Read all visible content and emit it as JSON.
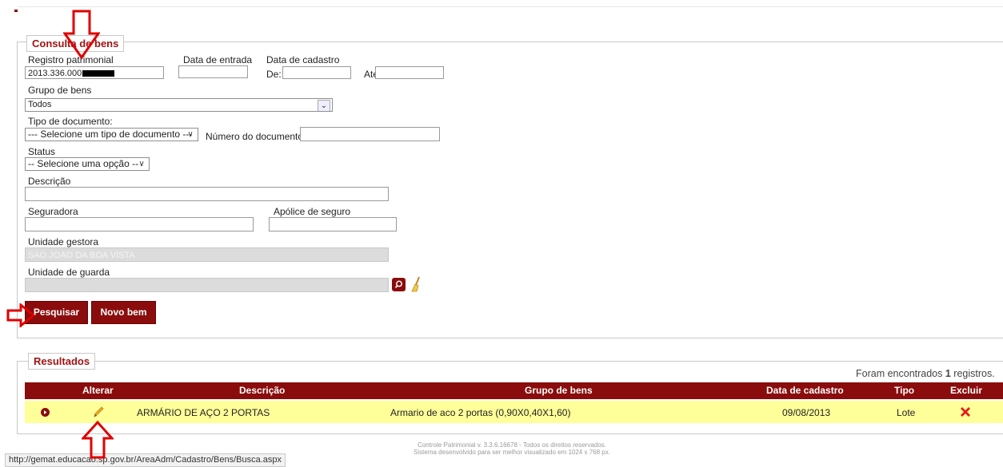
{
  "search": {
    "legend": "Consulta de bens",
    "registro_label": "Registro patrimonial",
    "registro_value": "2013.336.000",
    "data_entrada_label": "Data de entrada",
    "data_cadastro_label": "Data de cadastro",
    "de_label": "De:",
    "ate_label": "Até",
    "grupo_label": "Grupo de bens",
    "grupo_value": "Todos",
    "tipo_doc_label": "Tipo de documento:",
    "tipo_doc_value": "--- Selecione um tipo de documento ---",
    "numero_doc_label": "Número do documento:",
    "status_label": "Status",
    "status_value": "-- Selecione uma opção --",
    "descricao_label": "Descrição",
    "seguradora_label": "Seguradora",
    "apolice_label": "Apólice de seguro",
    "unidade_gestora_label": "Unidade gestora",
    "unidade_gestora_value": "SAO JOAO DA BOA VISTA",
    "unidade_guarda_label": "Unidade de guarda",
    "pesquisar_label": "Pesquisar",
    "novo_bem_label": "Novo bem"
  },
  "results": {
    "legend": "Resultados",
    "count_prefix": "Foram encontrados ",
    "count": "1",
    "count_suffix": " registros.",
    "columns": {
      "alterar": "Alterar",
      "descricao": "Descrição",
      "grupo": "Grupo de bens",
      "data": "Data de cadastro",
      "tipo": "Tipo",
      "excluir": "Excluir"
    },
    "rows": [
      {
        "descricao": "ARMÁRIO DE AÇO 2 PORTAS",
        "grupo": "Armario de aco 2 portas (0,90X0,40X1,60)",
        "data": "09/08/2013",
        "tipo": "Lote"
      }
    ]
  },
  "footer": {
    "line1": "Controle Patrimonial v. 3.3.6.16678 - Todos os direitos reservados.",
    "line2": "Sistema desenvolvido para ser melhor visualizado em 1024 x 768 px."
  },
  "status_bar": {
    "url": "http://gemat.educacao.sp.gov.br/AreaAdm/Cadastro/Bens/Busca.aspx"
  },
  "colors": {
    "brand": "#8b0c0c",
    "row_highlight": "#ffff99",
    "annotation_arrow": "#e00000",
    "delete_icon": "#e02020",
    "edit_icon": "#e0a020"
  },
  "icons": {
    "search": "search-icon",
    "clear": "broom-icon",
    "expand": "expand-icon",
    "edit": "pencil-icon",
    "delete": "delete-icon"
  }
}
